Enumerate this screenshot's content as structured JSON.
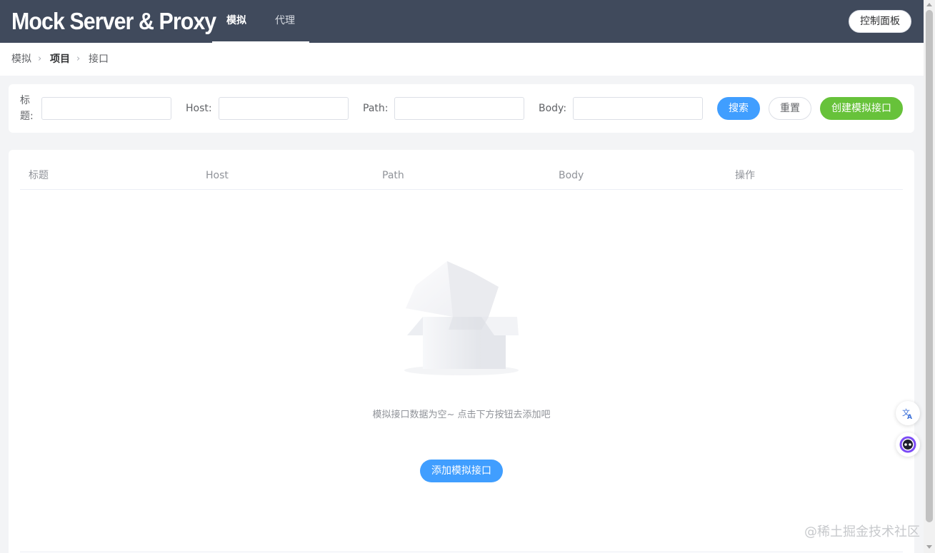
{
  "header": {
    "logo": "Mock Server & Proxy",
    "tabs": [
      {
        "label": "模拟",
        "active": true
      },
      {
        "label": "代理",
        "active": false
      }
    ],
    "dashboard_label": "控制面板",
    "background": "#404a5c"
  },
  "breadcrumb": [
    "模拟",
    "项目",
    "接口"
  ],
  "search": {
    "fields": [
      {
        "label": "标题:",
        "value": "",
        "placeholder": ""
      },
      {
        "label": "Host:",
        "value": "",
        "placeholder": ""
      },
      {
        "label": "Path:",
        "value": "",
        "placeholder": ""
      },
      {
        "label": "Body:",
        "value": "",
        "placeholder": ""
      }
    ],
    "search_label": "搜索",
    "reset_label": "重置",
    "create_label": "创建模拟接口"
  },
  "table": {
    "columns": [
      "标题",
      "Host",
      "Path",
      "Body",
      "操作"
    ],
    "empty_text": "模拟接口数据为空~ 点击下方按钮去添加吧",
    "add_label": "添加模拟接口"
  },
  "floating": {
    "translate_icon": "translate-icon",
    "assistant_icon": "robot-icon"
  },
  "watermark": "@稀土掘金技术社区",
  "colors": {
    "primary": "#409eff",
    "success": "#67c23a",
    "header": "#404a5c"
  }
}
